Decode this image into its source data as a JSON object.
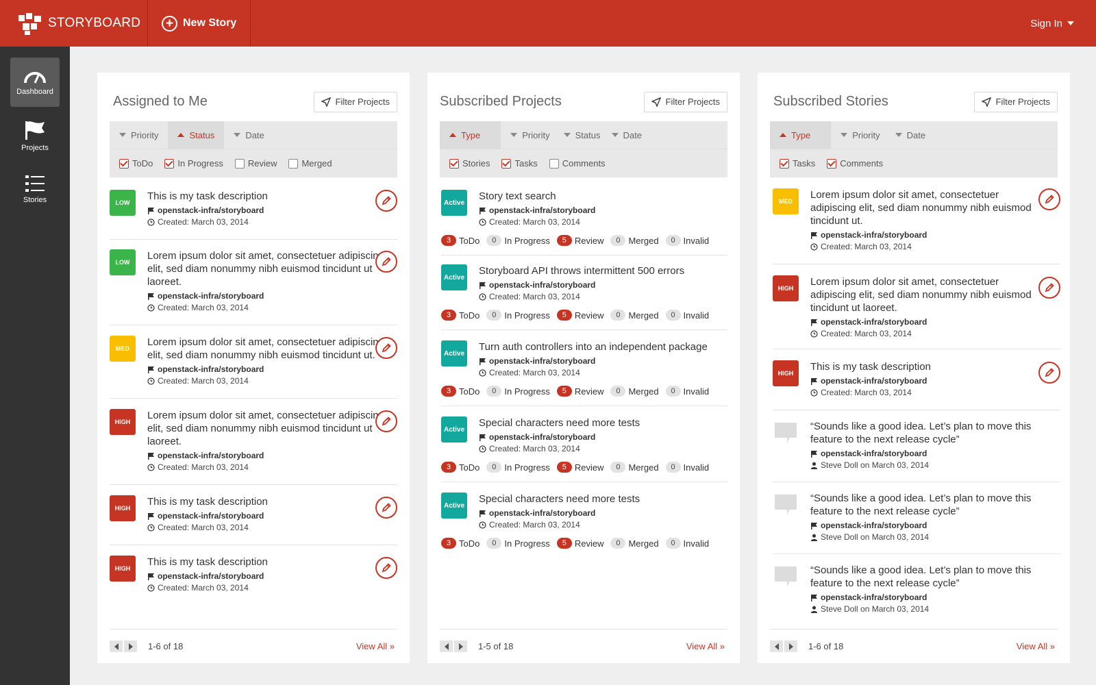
{
  "header": {
    "brand": "STORYBOARD",
    "new_story": "New Story",
    "signin": "Sign In"
  },
  "sidebar": {
    "items": [
      {
        "label": "Dashboard",
        "icon": "dashboard-gauge-icon"
      },
      {
        "label": "Projects",
        "icon": "flag-icon"
      },
      {
        "label": "Stories",
        "icon": "list-icon"
      }
    ]
  },
  "colors": {
    "brand_red": "#c63423",
    "low": "#3bb54a",
    "med": "#f9be00",
    "high": "#c63423",
    "active": "#12a89d"
  },
  "panels": {
    "assigned": {
      "title": "Assigned to Me",
      "filter": "Filter Projects",
      "sorts": [
        "Priority",
        "Status",
        "Date"
      ],
      "checks": [
        "ToDo",
        "In Progress",
        "Review",
        "Merged"
      ],
      "items": [
        {
          "badge": "LOW",
          "title": "This is my task description",
          "project": "openstack-infra/storyboard",
          "created": "Created: March 03, 2014"
        },
        {
          "badge": "LOW",
          "title": "Lorem ipsum dolor sit amet, consectetuer adipiscing elit, sed diam nonummy nibh euismod tincidunt ut laoreet.",
          "project": "openstack-infra/storyboard",
          "created": "Created: March 03, 2014"
        },
        {
          "badge": "MED",
          "title": "Lorem ipsum dolor sit amet, consectetuer adipiscing elit, sed diam nonummy nibh euismod tincidunt ut.",
          "project": "openstack-infra/storyboard",
          "created": "Created: March 03, 2014"
        },
        {
          "badge": "HIGH",
          "title": "Lorem ipsum dolor sit amet, consectetuer adipiscing elit, sed diam nonummy nibh euismod tincidunt ut laoreet.",
          "project": "openstack-infra/storyboard",
          "created": "Created: March 03, 2014"
        },
        {
          "badge": "HIGH",
          "title": "This is my task description",
          "project": "openstack-infra/storyboard",
          "created": "Created: March 03, 2014"
        },
        {
          "badge": "HIGH",
          "title": "This is my task description",
          "project": "openstack-infra/storyboard",
          "created": "Created: March 03, 2014"
        }
      ],
      "range": "1-6 of 18",
      "view_all": "View All »"
    },
    "projects": {
      "title": "Subscribed Projects",
      "filter": "Filter Projects",
      "sorts": [
        "Type",
        "Priority",
        "Status",
        "Date"
      ],
      "checks": [
        "Stories",
        "Tasks",
        "Comments"
      ],
      "count_labels": [
        "ToDo",
        "In Progress",
        "Review",
        "Merged",
        "Invalid"
      ],
      "items": [
        {
          "badge": "Active",
          "title": "Story text search",
          "project": "openstack-infra/storyboard",
          "created": "Created: March 03, 2014",
          "counts": [
            "3",
            "0",
            "5",
            "0",
            "0"
          ]
        },
        {
          "badge": "Active",
          "title": "Storyboard API throws intermittent 500 errors",
          "project": "openstack-infra/storyboard",
          "created": "Created: March 03, 2014",
          "counts": [
            "3",
            "0",
            "5",
            "0",
            "0"
          ]
        },
        {
          "badge": "Active",
          "title": "Turn auth controllers into an independent package",
          "project": "openstack-infra/storyboard",
          "created": "Created: March 03, 2014",
          "counts": [
            "3",
            "0",
            "5",
            "0",
            "0"
          ]
        },
        {
          "badge": "Active",
          "title": "Special characters need more tests",
          "project": "openstack-infra/storyboard",
          "created": "Created: March 03, 2014",
          "counts": [
            "3",
            "0",
            "5",
            "0",
            "0"
          ]
        },
        {
          "badge": "Active",
          "title": "Special characters need more tests",
          "project": "openstack-infra/storyboard",
          "created": "Created: March 03, 2014",
          "counts": [
            "3",
            "0",
            "5",
            "0",
            "0"
          ]
        }
      ],
      "range": "1-5 of 18",
      "view_all": "View All »"
    },
    "stories": {
      "title": "Subscribed Stories",
      "filter": "Filter Projects",
      "sorts": [
        "Type",
        "Priority",
        "Date"
      ],
      "checks": [
        "Tasks",
        "Comments"
      ],
      "items": [
        {
          "badge": "MED",
          "title": "Lorem ipsum dolor sit amet, consectetuer adipiscing elit, sed diam nonummy nibh euismod tincidunt ut.",
          "project": "openstack-infra/storyboard",
          "created": "Created: March 03, 2014"
        },
        {
          "badge": "HIGH",
          "title": "Lorem ipsum dolor sit amet, consectetuer adipiscing elit, sed diam nonummy nibh euismod tincidunt ut laoreet.",
          "project": "openstack-infra/storyboard",
          "created": "Created: March 03, 2014"
        },
        {
          "badge": "HIGH",
          "title": "This is my task description",
          "project": "openstack-infra/storyboard",
          "created": "Created: March 03, 2014"
        }
      ],
      "comments": [
        {
          "text": "“Sounds like a good idea. Let’s plan to move this feature to the next release cycle”",
          "project": "openstack-infra/storyboard",
          "author": "Steve Doll on March 03, 2014"
        },
        {
          "text": "“Sounds like a good idea. Let’s plan to move this feature to the next release cycle”",
          "project": "openstack-infra/storyboard",
          "author": "Steve Doll on March 03, 2014"
        },
        {
          "text": "“Sounds like a good idea. Let’s plan to move this feature to the next release cycle”",
          "project": "openstack-infra/storyboard",
          "author": "Steve Doll on March 03, 2014"
        }
      ],
      "range": "1-6 of 18",
      "view_all": "View All »"
    }
  }
}
